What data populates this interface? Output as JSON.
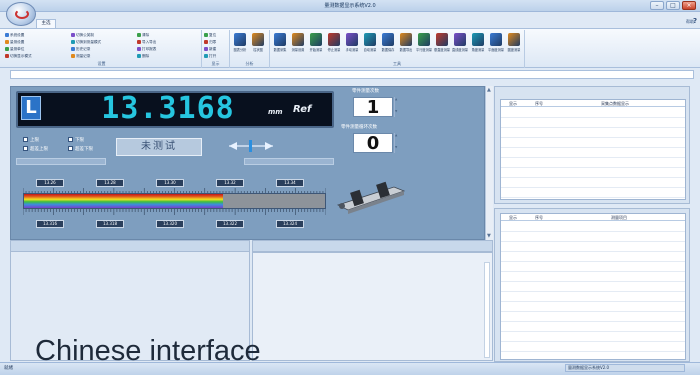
{
  "window": {
    "title": "量测数据显示系统V2.0",
    "min": "–",
    "max": "□",
    "close": "×"
  },
  "tabs": [
    {
      "label": "主选"
    }
  ],
  "help": {
    "label": "帮助",
    "icon": "?"
  },
  "ribbon": {
    "group1": {
      "label": "设置",
      "commands": [
        "系统设置",
        "量测设置",
        "量测单位",
        "切换显示模式",
        "切换公英制",
        "切换到测量模式",
        "历史记录",
        "测量记录",
        "清除",
        "导入导出",
        "打印报表",
        "删除"
      ]
    },
    "group2": {
      "label": "显示",
      "commands": [
        "复位",
        "归零",
        "新建",
        "打开"
      ]
    },
    "group3": {
      "label": "分析",
      "big": [
        "图表分析",
        "柱状图"
      ]
    },
    "group4": {
      "label": "工具",
      "big": [
        "数据采集",
        "测量设置",
        "开始测量",
        "停止测量",
        "手动测量",
        "自动测量",
        "数据保存",
        "数据导出",
        "平行度测量",
        "垂直度测量",
        "直线度测量",
        "角度测量",
        "平面度测量",
        "圆度测量"
      ]
    }
  },
  "display": {
    "mode": "L",
    "value": "13.3168",
    "unit": "mm",
    "ref_label": "Ref",
    "counter1_label": "零件测量次数",
    "counter1_value": "1",
    "counter2_label": "零件测量循环次数",
    "counter2_value": "0",
    "checkboxes": [
      "上限",
      "下限",
      "超差上限",
      "超差下限"
    ],
    "status": "未测试"
  },
  "scale": {
    "top_ticks": [
      "13.26",
      "13.28",
      "13.30",
      "13.32",
      "13.34"
    ],
    "bottom_ticks": [
      "13.316",
      "13.318",
      "13.320",
      "13.322",
      "13.324"
    ],
    "fill_fraction": 0.66
  },
  "table1": {
    "columns": [
      "显示",
      "序号",
      "采集点数据显示"
    ]
  },
  "table2": {
    "columns": [
      "显示",
      "序号",
      "测量项目"
    ]
  },
  "caption": "Chinese interface",
  "statusbar": {
    "left": "就绪",
    "right": "量测数据显示系统V2.0"
  }
}
